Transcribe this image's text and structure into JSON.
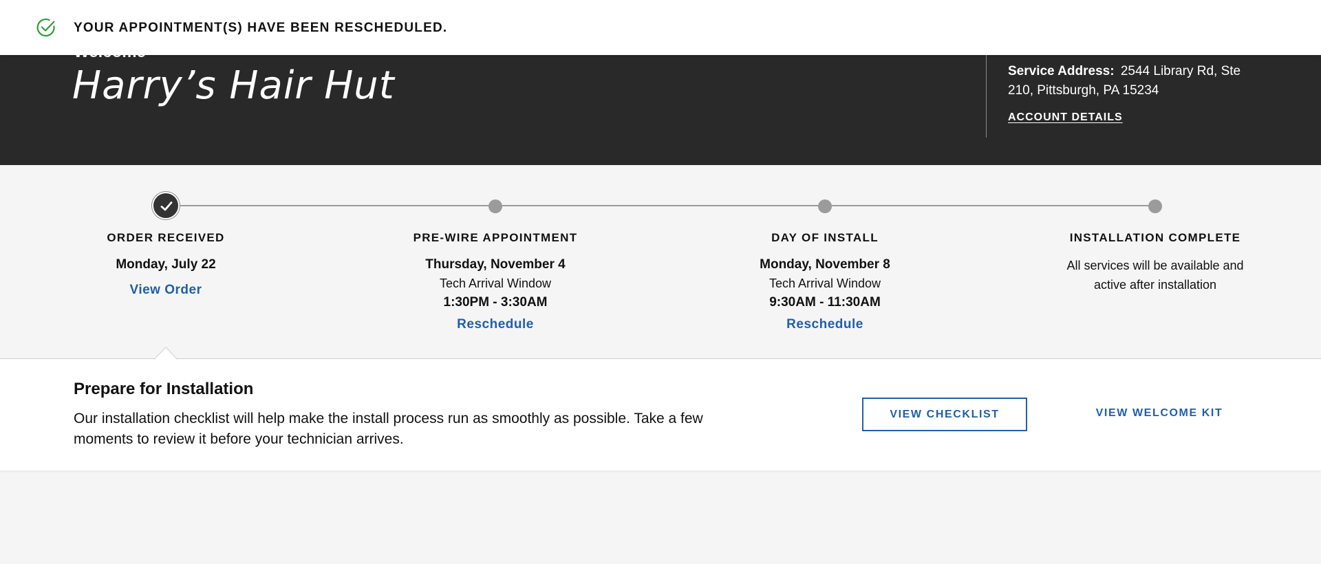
{
  "notification": {
    "message": "YOUR APPOINTMENT(S) HAVE BEEN RESCHEDULED.",
    "icon": "check-circle-icon",
    "icon_color": "#2e9c3a"
  },
  "header": {
    "welcome": "Welcome",
    "business_name": "Harry’s Hair Hut",
    "service_address_label": "Service Address:",
    "service_address": "2544 Library Rd, Ste 210, Pittsburgh, PA 15234",
    "account_details_link": "ACCOUNT DETAILS"
  },
  "timeline": {
    "steps": [
      {
        "title": "ORDER RECEIVED",
        "date": "Monday, July 22",
        "link": "View Order",
        "status": "complete"
      },
      {
        "title": "PRE-WIRE APPOINTMENT",
        "date": "Thursday, November 4",
        "window_label": "Tech Arrival Window",
        "window": "1:30PM - 3:30AM",
        "link": "Reschedule",
        "status": "pending"
      },
      {
        "title": "DAY OF INSTALL",
        "date": "Monday, November 8",
        "window_label": "Tech Arrival Window",
        "window": "9:30AM - 11:30AM",
        "link": "Reschedule",
        "status": "pending"
      },
      {
        "title": "INSTALLATION COMPLETE",
        "description": "All services will be available and active after installation",
        "status": "pending"
      }
    ]
  },
  "prepare": {
    "title": "Prepare for Installation",
    "description": "Our installation checklist will help make the install process run as smoothly as possible. Take a few moments to review it before your technician arrives.",
    "checklist_button": "VIEW CHECKLIST",
    "welcome_kit_link": "VIEW WELCOME KIT"
  },
  "colors": {
    "accent": "#1f5fa8",
    "header_bg": "#292929",
    "success": "#2e9c3a"
  }
}
